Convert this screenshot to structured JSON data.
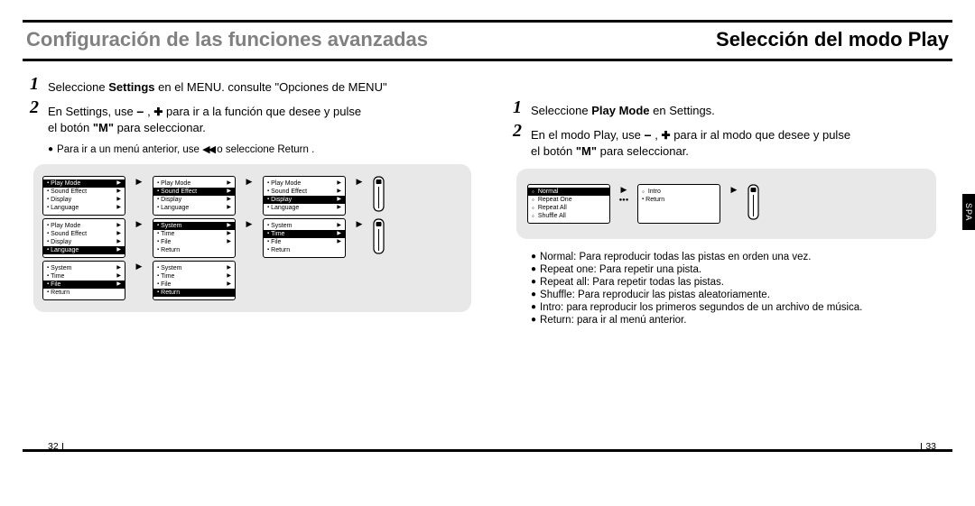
{
  "titles": {
    "left": "Configuración de las funciones avanzadas",
    "right": "Selección del modo Play"
  },
  "side_tab": "SPA",
  "left_page": {
    "step1": {
      "pre": "Seleccione ",
      "bold": "Settings",
      "post": " en el MENU. consulte \"Opciones de MENU\""
    },
    "step2": {
      "l1a": "En Settings, use ",
      "l1b": " para ir a la función que desee y pulse",
      "l2a": "el botón ",
      "l2m": "\"M\"",
      "l2b": " para seleccionar."
    },
    "note": {
      "a": "Para ir a un menú anterior, use ",
      "b": " o seleccione Return ."
    },
    "menu1": {
      "i0": "Play Mode",
      "i1": "Sound Effect",
      "i2": "Display",
      "i3": "Language"
    },
    "menu2": {
      "i0": "System",
      "i1": "Time",
      "i2": "File",
      "i3": "Return"
    },
    "pagenum": "32"
  },
  "right_page": {
    "step1": {
      "pre": "Seleccione ",
      "bold": "Play Mode",
      "post": " en Settings."
    },
    "step2": {
      "l1a": "En el modo Play, use ",
      "l1b": " para ir al modo que desee y pulse",
      "l2a": "el botón ",
      "l2m": "\"M\"",
      "l2b": " para seleccionar."
    },
    "menuA": {
      "i0": "Normal",
      "i1": "Repeat One",
      "i2": "Repeat All",
      "i3": "Shuffle All"
    },
    "menuB": {
      "i0": "Intro",
      "i1": "Return"
    },
    "notes": {
      "n0": "Normal: Para reproducir todas las pistas en orden una vez.",
      "n1": "Repeat one: Para repetir una pista.",
      "n2": "Repeat all: Para repetir todas las pistas.",
      "n3": "Shuffle: Para reproducir las pistas aleatoriamente.",
      "n4": "Intro: para reproducir los primeros segundos de un archivo de música.",
      "n5": "Return: para ir al menú anterior."
    },
    "pagenum": "33"
  }
}
